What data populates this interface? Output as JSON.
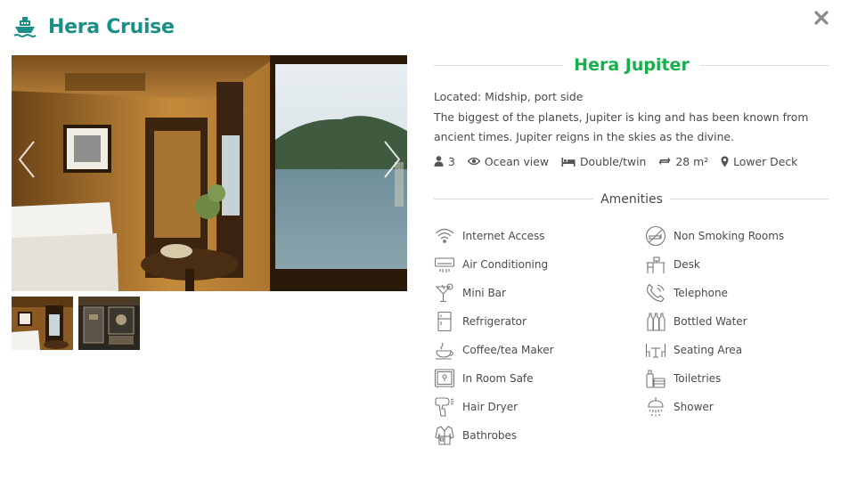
{
  "header": {
    "title": "Hera Cruise",
    "brand_icon": "ship-icon"
  },
  "room": {
    "name": "Hera Jupiter",
    "location": "Located: Midship, port side",
    "description": "The biggest of the planets, Jupiter is king and has been known from ancient times. Jupiter reigns in the skies as the divine.",
    "specs": {
      "occupancy": "3",
      "view": "Ocean view",
      "bed": "Double/twin",
      "size": "28 m²",
      "deck": "Lower Deck"
    }
  },
  "amenities": {
    "title": "Amenities",
    "left": [
      {
        "label": "Internet Access",
        "icon": "wifi-icon"
      },
      {
        "label": "Air Conditioning",
        "icon": "air-conditioner-icon"
      },
      {
        "label": "Mini Bar",
        "icon": "cocktail-icon"
      },
      {
        "label": "Refrigerator",
        "icon": "refrigerator-icon"
      },
      {
        "label": "Coffee/tea Maker",
        "icon": "coffee-cup-icon"
      },
      {
        "label": "In Room Safe",
        "icon": "safe-icon"
      },
      {
        "label": "Hair Dryer",
        "icon": "hair-dryer-icon"
      },
      {
        "label": "Bathrobes",
        "icon": "bathrobe-icon"
      }
    ],
    "right": [
      {
        "label": "Non Smoking Rooms",
        "icon": "no-smoking-icon"
      },
      {
        "label": "Desk",
        "icon": "desk-icon"
      },
      {
        "label": "Telephone",
        "icon": "telephone-icon"
      },
      {
        "label": "Bottled Water",
        "icon": "water-bottles-icon"
      },
      {
        "label": "Seating Area",
        "icon": "seating-area-icon"
      },
      {
        "label": "Toiletries",
        "icon": "toiletries-icon"
      },
      {
        "label": "Shower",
        "icon": "shower-icon"
      }
    ]
  },
  "colors": {
    "brand": "#1b8f87",
    "title_green": "#15b04a",
    "text": "#4a4a4a",
    "divider": "#d9d9d9"
  }
}
